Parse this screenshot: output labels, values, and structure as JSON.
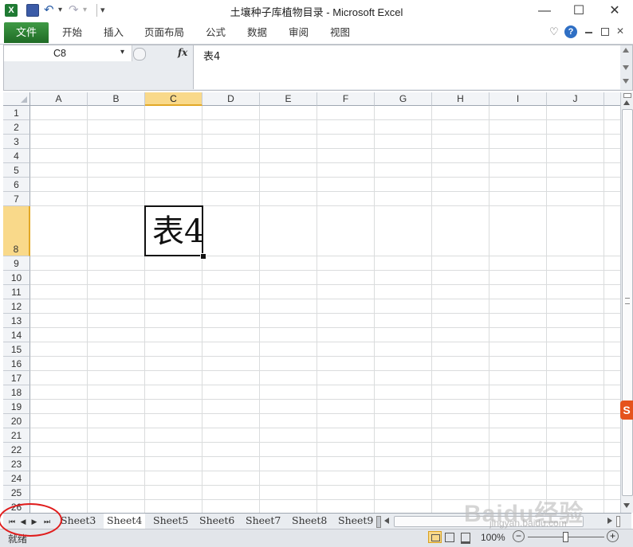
{
  "window": {
    "title": "土壤种子库植物目录 - Microsoft Excel",
    "minimize": "—",
    "maximize": "☐",
    "close": "✕"
  },
  "quick_access": {
    "undo": "↶",
    "redo": "↷",
    "customize": "▾"
  },
  "ribbon": {
    "file_tab": "文件",
    "tabs": [
      "开始",
      "插入",
      "页面布局",
      "公式",
      "数据",
      "审阅",
      "视图"
    ],
    "help": "?",
    "heart": "♡"
  },
  "formula_bar": {
    "name_box": "C8",
    "name_box_arrow": "▾",
    "fx": "fx",
    "content": "表4"
  },
  "grid": {
    "columns": [
      "A",
      "B",
      "C",
      "D",
      "E",
      "F",
      "G",
      "H",
      "I",
      "J"
    ],
    "rows": [
      "1",
      "2",
      "3",
      "4",
      "5",
      "6",
      "7",
      "8",
      "9",
      "10",
      "11",
      "12",
      "13",
      "14",
      "15",
      "16",
      "17",
      "18",
      "19",
      "20",
      "21",
      "22",
      "23",
      "24",
      "25",
      "26"
    ],
    "selected_column": "C",
    "selected_row": "8",
    "cell_c8": "表4"
  },
  "sheet_tabs": {
    "nav": [
      "⏮",
      "◀",
      "▶",
      "⏭"
    ],
    "tabs": [
      "Sheet3",
      "Sheet4",
      "Sheet5",
      "Sheet6",
      "Sheet7",
      "Sheet8",
      "Sheet9"
    ],
    "active": "Sheet4"
  },
  "status_bar": {
    "status": "就绪",
    "zoom": "100%",
    "zoom_out": "−",
    "zoom_in": "+"
  },
  "watermark": {
    "text": "Baidu经验",
    "url": "jingyan.baidu.com",
    "badge": "S"
  },
  "colors": {
    "file_tab_green": "#2e7d32",
    "selected_header": "#f9d98a",
    "annotation_red": "#e01c1c"
  }
}
